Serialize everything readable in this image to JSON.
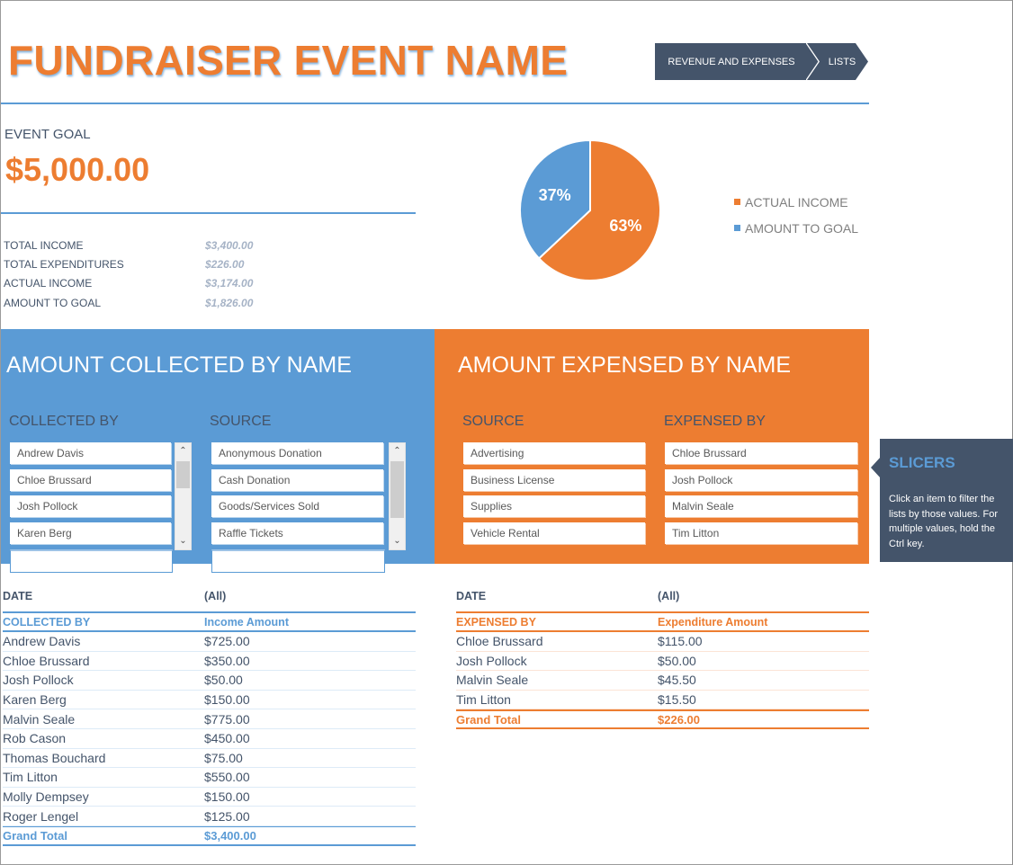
{
  "title": "FUNDRAISER EVENT NAME",
  "nav": {
    "revenue_label": "REVENUE AND EXPENSES",
    "lists_label": "LISTS"
  },
  "goal": {
    "label": "EVENT GOAL",
    "value": "$5,000.00"
  },
  "summary": [
    {
      "label": "TOTAL INCOME",
      "value": "$3,400.00"
    },
    {
      "label": "TOTAL EXPENDITURES",
      "value": "$226.00"
    },
    {
      "label": "ACTUAL INCOME",
      "value": "$3,174.00"
    },
    {
      "label": "AMOUNT TO GOAL",
      "value": "$1,826.00"
    }
  ],
  "chart_data": {
    "type": "pie",
    "title": "",
    "slices": [
      {
        "label": "ACTUAL INCOME",
        "value": 63,
        "display": "63%",
        "color": "#ed7d31"
      },
      {
        "label": "AMOUNT TO GOAL",
        "value": 37,
        "display": "37%",
        "color": "#5b9bd5"
      }
    ],
    "legend_position": "right"
  },
  "collected_panel": {
    "title": "AMOUNT COLLECTED BY NAME",
    "collected_by": {
      "header": "COLLECTED BY",
      "items": [
        "Andrew Davis",
        "Chloe Brussard",
        "Josh Pollock",
        "Karen Berg"
      ]
    },
    "source": {
      "header": "SOURCE",
      "items": [
        "Anonymous Donation",
        "Cash Donation",
        "Goods/Services Sold",
        "Raffle Tickets"
      ]
    }
  },
  "expensed_panel": {
    "title": "AMOUNT EXPENSED BY NAME",
    "source": {
      "header": "SOURCE",
      "items": [
        "Advertising",
        "Business License",
        "Supplies",
        "Vehicle Rental"
      ]
    },
    "expensed_by": {
      "header": "EXPENSED BY",
      "items": [
        "Chloe Brussard",
        "Josh Pollock",
        "Malvin Seale",
        "Tim Litton"
      ]
    }
  },
  "callout": {
    "title": "SLICERS",
    "body": "Click an item to filter the lists by those values. For multiple values, hold the Ctrl key."
  },
  "income_pivot": {
    "filter_label": "DATE",
    "filter_value": "(All)",
    "columns": [
      "COLLECTED BY",
      "Income Amount"
    ],
    "rows": [
      [
        "Andrew Davis",
        "$725.00"
      ],
      [
        "Chloe Brussard",
        "$350.00"
      ],
      [
        "Josh Pollock",
        "$50.00"
      ],
      [
        "Karen Berg",
        "$150.00"
      ],
      [
        "Malvin Seale",
        "$775.00"
      ],
      [
        "Rob Cason",
        "$450.00"
      ],
      [
        "Thomas Bouchard",
        "$75.00"
      ],
      [
        "Tim Litton",
        "$550.00"
      ],
      [
        "Molly Dempsey",
        "$150.00"
      ],
      [
        "Roger Lengel",
        "$125.00"
      ]
    ],
    "total": [
      "Grand Total",
      "$3,400.00"
    ]
  },
  "expense_pivot": {
    "filter_label": "DATE",
    "filter_value": "(All)",
    "columns": [
      "EXPENSED BY",
      "Expenditure Amount"
    ],
    "rows": [
      [
        "Chloe Brussard",
        "$115.00"
      ],
      [
        "Josh Pollock",
        "$50.00"
      ],
      [
        "Malvin Seale",
        "$45.50"
      ],
      [
        "Tim Litton",
        "$15.50"
      ]
    ],
    "total": [
      "Grand Total",
      "$226.00"
    ]
  },
  "colors": {
    "accent_orange": "#ed7d31",
    "accent_blue": "#5b9bd5",
    "dark_slate": "#44546a"
  }
}
